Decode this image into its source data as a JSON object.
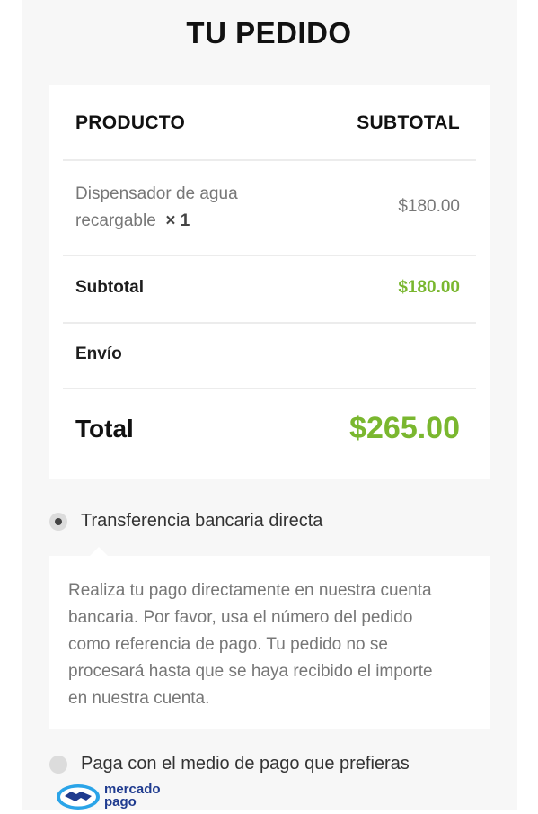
{
  "page": {
    "title": "TU PEDIDO"
  },
  "order_table": {
    "header": {
      "product": "PRODUCTO",
      "subtotal": "SUBTOTAL"
    },
    "items": [
      {
        "name_line1": "Dispensador de agua",
        "name_line2": "recargable",
        "qty": "× 1",
        "price": "$180.00"
      }
    ],
    "subtotal": {
      "label": "Subtotal",
      "value": "$180.00"
    },
    "shipping": {
      "label": "Envío",
      "value": ""
    },
    "total": {
      "label": "Total",
      "value": "$265.00"
    }
  },
  "payment_methods": [
    {
      "label": "Transferencia bancaria directa",
      "selected": true,
      "description": "Realiza tu pago directamente en nuestra cuenta bancaria. Por favor, usa el número del pedido como referencia de pago. Tu pedido no se procesará hasta que se haya recibido el importe en nuestra cuenta.",
      "description_lines": [
        "Realiza tu pago directamente en nuestra cuenta",
        "bancaria. Por favor, usa el número del pedido",
        "como referencia de pago. Tu pedido no se",
        "procesará hasta que se haya recibido el importe",
        "en nuestra cuenta."
      ]
    },
    {
      "label": "Paga con el medio de pago que prefieras",
      "selected": false,
      "logo": {
        "icon": "handshake-icon",
        "text_line1": "mercado",
        "text_line2": "pago"
      }
    }
  ],
  "colors": {
    "accent_green": "#7ab72f",
    "logo_blue": "#1f3b8f",
    "logo_light_blue": "#2aa4e8"
  }
}
